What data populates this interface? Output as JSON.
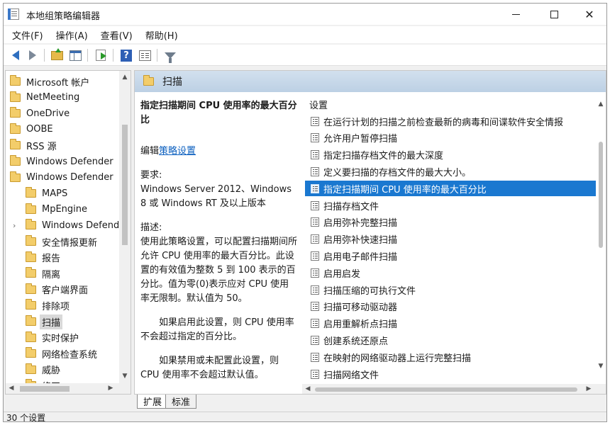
{
  "window": {
    "title": "本地组策略编辑器",
    "minimize_icon": "minimize-icon",
    "maximize_icon": "maximize-icon",
    "close_glyph": "✕"
  },
  "menu": [
    "文件(F)",
    "操作(A)",
    "查看(V)",
    "帮助(H)"
  ],
  "toolbar_icons": [
    "back-arrow-icon",
    "forward-arrow-icon",
    "folder-up-icon",
    "show-hide-tree-icon",
    "export-list-icon",
    "help-icon",
    "properties-icon",
    "filter-icon"
  ],
  "toolbar": {
    "help_glyph": "?"
  },
  "tree": [
    {
      "label": "Microsoft 帐户",
      "level": 0
    },
    {
      "label": "NetMeeting",
      "level": 0
    },
    {
      "label": "OneDrive",
      "level": 0
    },
    {
      "label": "OOBE",
      "level": 0
    },
    {
      "label": "RSS 源",
      "level": 0
    },
    {
      "label": "Windows Defender",
      "level": 0
    },
    {
      "label": "Windows Defender",
      "level": 0
    },
    {
      "label": "MAPS",
      "level": 1
    },
    {
      "label": "MpEngine",
      "level": 1
    },
    {
      "label": "Windows Defender",
      "level": 1,
      "expander": "›"
    },
    {
      "label": "安全情报更新",
      "level": 1
    },
    {
      "label": "报告",
      "level": 1
    },
    {
      "label": "隔离",
      "level": 1
    },
    {
      "label": "客户端界面",
      "level": 1
    },
    {
      "label": "排除项",
      "level": 1
    },
    {
      "label": "扫描",
      "level": 1,
      "selected": true
    },
    {
      "label": "实时保护",
      "level": 1
    },
    {
      "label": "网络检查系统",
      "level": 1
    },
    {
      "label": "威胁",
      "level": 1
    },
    {
      "label": "修正",
      "level": 1
    }
  ],
  "pane_header": {
    "title": "扫描"
  },
  "description": {
    "title": "指定扫描期间 CPU 使用率的最大百分比",
    "edit_prefix": "编辑",
    "edit_link": "策略设置",
    "requirements_label": "要求:",
    "requirements_text": "Windows Server 2012、Windows 8 或 Windows RT 及以上版本",
    "description_label": "描述:",
    "description_text": "使用此策略设置，可以配置扫描期间所允许 CPU 使用率的最大百分比。此设置的有效值为整数 5 到 100 表示的百分比。值为零(0)表示应对 CPU 使用率无限制。默认值为 50。",
    "enabled_text": "如果启用此设置，则 CPU 使用率不会超过指定的百分比。",
    "disabled_text": "如果禁用或未配置此设置，则 CPU 使用率不会超过默认值。"
  },
  "settings": {
    "header": "设置",
    "rows": [
      "在运行计划的扫描之前检查最新的病毒和间谍软件安全情报",
      "允许用户暂停扫描",
      "指定扫描存档文件的最大深度",
      "定义要扫描的存档文件的最大大小。",
      "指定扫描期间 CPU 使用率的最大百分比",
      "扫描存档文件",
      "启用弥补完整扫描",
      "启用弥补快速扫描",
      "启用电子邮件扫描",
      "启用启发",
      "扫描压缩的可执行文件",
      "扫描可移动驱动器",
      "启用重解析点扫描",
      "创建系统还原点",
      "在映射的网络驱动器上运行完整扫描",
      "扫描网络文件"
    ],
    "selected_index": 4
  },
  "tabs": [
    "扩展",
    "标准"
  ],
  "status": {
    "text": "30 个设置"
  },
  "colors": {
    "selection": "#1a78d0",
    "link": "#0b5fbf",
    "header_bg": "#bcd0e4"
  }
}
